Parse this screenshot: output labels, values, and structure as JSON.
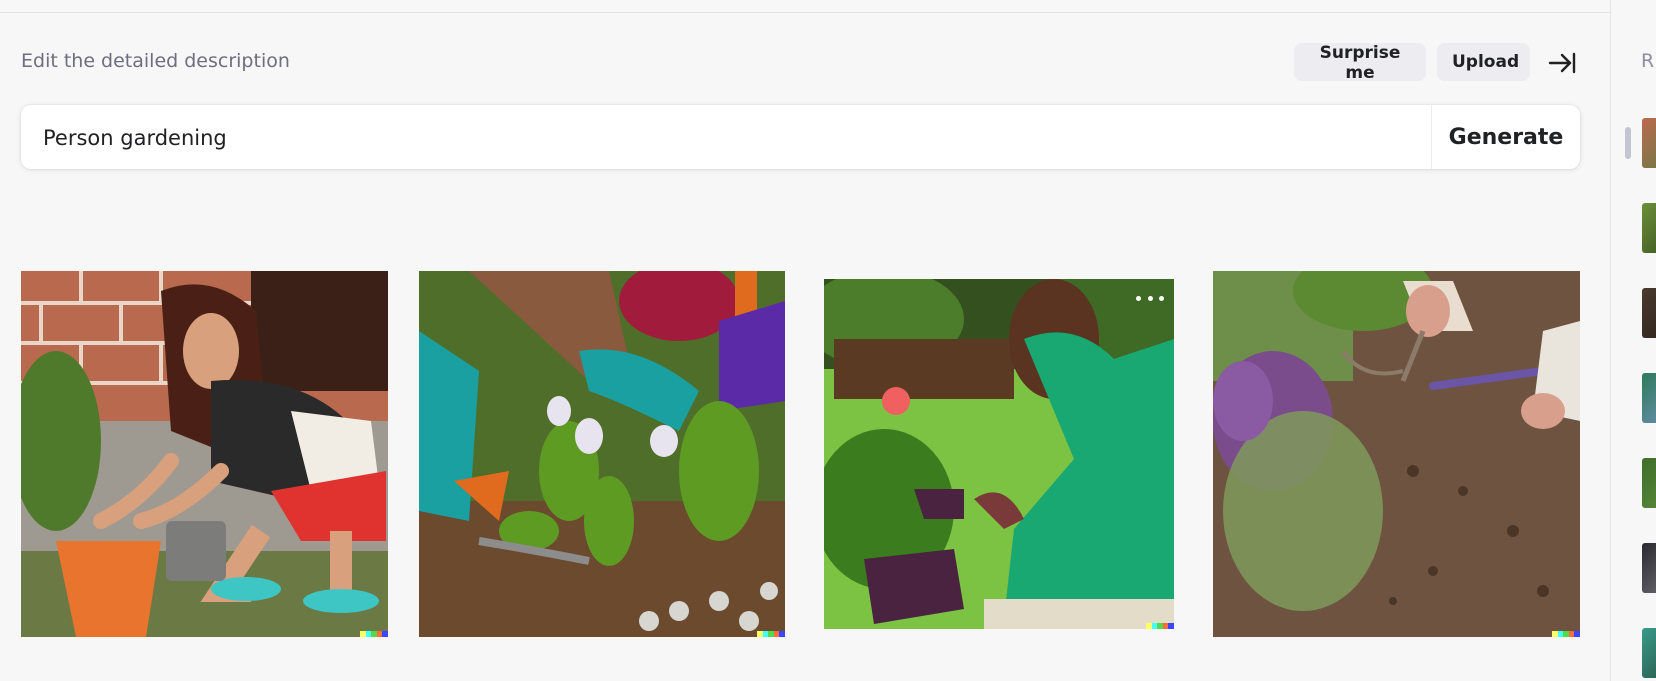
{
  "header": {
    "section_label": "Edit the detailed description",
    "surprise_label": "Surprise me",
    "upload_label": "Upload",
    "collapse_icon": "collapse-panel-icon"
  },
  "prompt": {
    "value": "Person gardening",
    "generate_label": "Generate"
  },
  "results": [
    {
      "subject": "woman crouching repotting plant"
    },
    {
      "subject": "gloved hands planting flowers"
    },
    {
      "subject": "man in green shirt tending plants",
      "has_menu": true
    },
    {
      "subject": "hand tool tilling soil"
    }
  ],
  "sidebar": {
    "title": "R",
    "history_count": 7
  },
  "colors": {
    "background": "#f7f7f8",
    "pill": "#ececf1",
    "text": "#202123",
    "muted": "#6e6e80",
    "signature": [
      "#ffff66",
      "#42ffff",
      "#51da4c",
      "#ff6e3c",
      "#3c46ff"
    ]
  }
}
